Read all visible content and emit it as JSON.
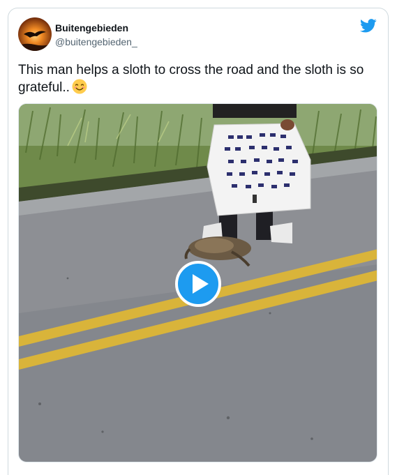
{
  "tweet": {
    "author": {
      "name": "Buitengebieden",
      "handle": "@buitengebieden_",
      "avatar_icon": "sunset-bird-avatar"
    },
    "text": "This man helps a sloth to cross the road and the sloth is so grateful..",
    "emoji": "😊",
    "brand_icon": "twitter-bird-icon",
    "brand_color": "#1d9bf0",
    "media": {
      "type": "video",
      "play_icon": "play-icon"
    }
  }
}
